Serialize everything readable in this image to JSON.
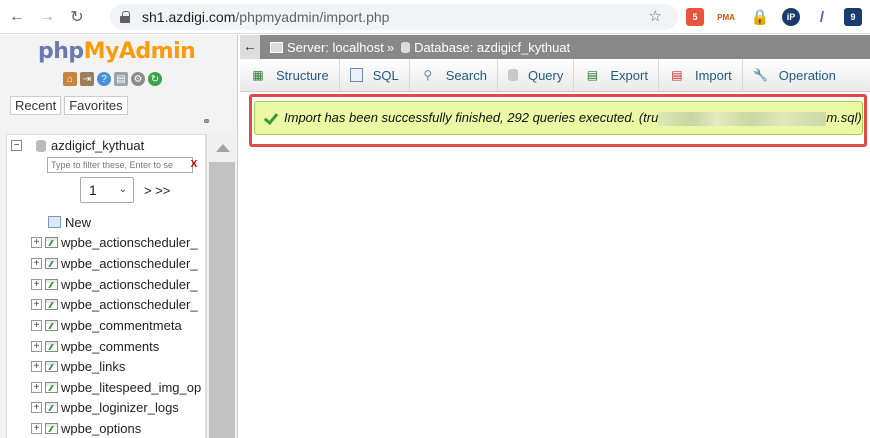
{
  "browser": {
    "url_host": "sh1.azdigi.com",
    "url_path": "/phpmyadmin/import.php",
    "extensions": [
      {
        "name": "extension-red",
        "label": "5"
      },
      {
        "name": "extension-pma",
        "label": "PMA"
      },
      {
        "name": "extension-lock",
        "label": "🔒"
      },
      {
        "name": "extension-ip",
        "label": "iP"
      },
      {
        "name": "extension-feather",
        "label": "/"
      },
      {
        "name": "extension-counter",
        "label": "9"
      }
    ]
  },
  "sidebar": {
    "logo_part1": "php",
    "logo_part2": "MyAdmin",
    "recent_label": "Recent",
    "favorites_label": "Favorites",
    "database": "azdigicf_kythuat",
    "filter_placeholder": "Type to filter these, Enter to se",
    "filter_clear": "X",
    "page_value": "1",
    "page_next": "> >>",
    "new_label": "New",
    "tables": [
      "wpbe_actionscheduler_",
      "wpbe_actionscheduler_",
      "wpbe_actionscheduler_",
      "wpbe_actionscheduler_",
      "wpbe_commentmeta",
      "wpbe_comments",
      "wpbe_links",
      "wpbe_litespeed_img_op",
      "wpbe_loginizer_logs",
      "wpbe_options"
    ]
  },
  "breadcrumb": {
    "collapse": "←",
    "server": "Server: localhost",
    "separator": "»",
    "database": "Database: azdigicf_kythuat"
  },
  "tabs": [
    "Structure",
    "SQL",
    "Search",
    "Query",
    "Export",
    "Import",
    "Operation"
  ],
  "notice": {
    "text_before": "Import has been successfully finished, 292 queries executed. (tru",
    "text_after": "m.sql)",
    "accent": "#e04a4a"
  }
}
